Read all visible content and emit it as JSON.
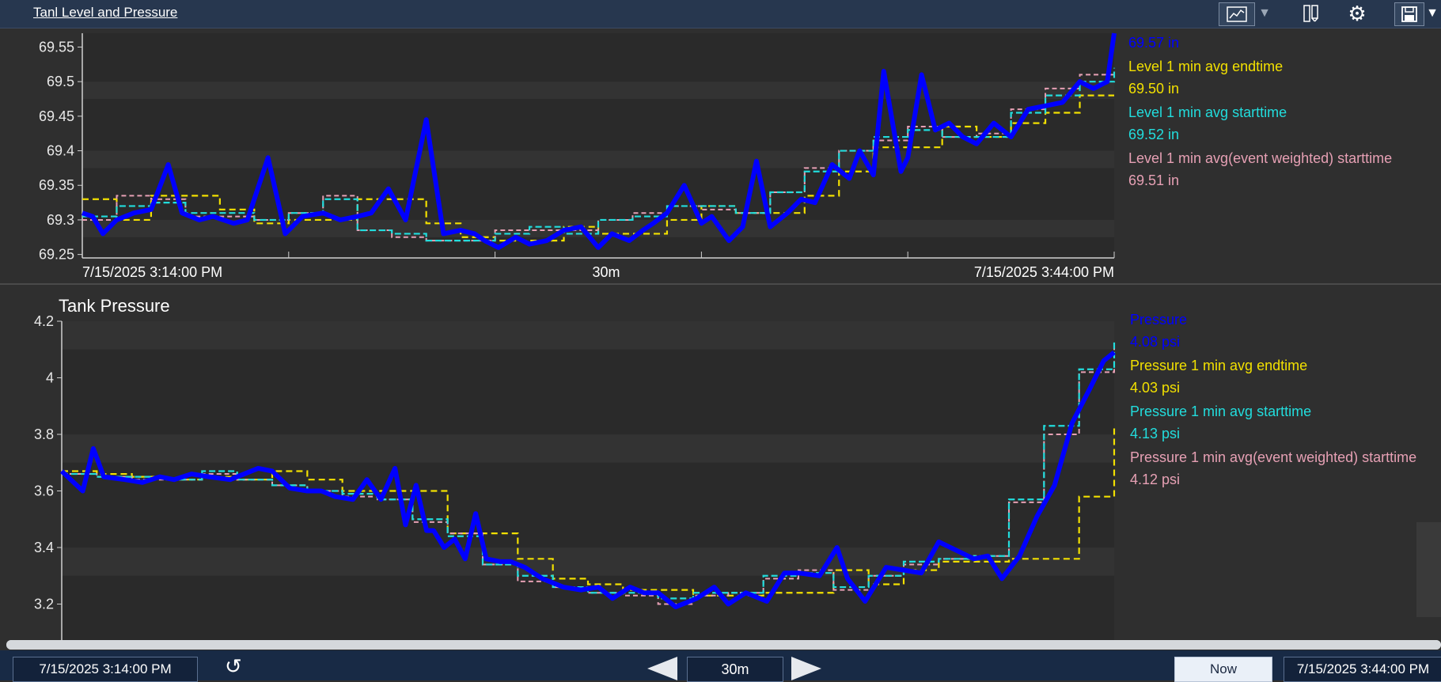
{
  "window": {
    "title": "Tanl Level and Pressure"
  },
  "toolbar": {
    "trend_icon": "trend-chart-icon",
    "caret_icon": "caret-down-icon",
    "columns_icon": "columns-icon",
    "gear_icon": "gear-icon",
    "save_icon": "save-icon"
  },
  "colors": {
    "raw": "#0000ff",
    "endtime": "#f2e000",
    "starttime": "#22dddd",
    "weighted": "#e6a0b4",
    "plot_bg": "#2a2a2a",
    "band": "#333333"
  },
  "chart_data": [
    {
      "type": "line",
      "title": "",
      "x_labels": [
        "7/15/2025 3:14:00 PM",
        "30m",
        "7/15/2025 3:44:00 PM"
      ],
      "yticks": [
        69.25,
        69.3,
        69.35,
        69.4,
        69.45,
        69.5,
        69.55
      ],
      "ytick_labels": [
        "69.25",
        "69.3",
        "69.35",
        "69.4",
        "69.45",
        "69.5",
        "69.55"
      ],
      "ylim": [
        69.245,
        69.57
      ],
      "xlim": [
        0,
        30
      ],
      "legend": [
        {
          "name": "",
          "value": "69.57 in",
          "color_key": "raw"
        },
        {
          "name": "Level 1 min avg endtime",
          "value": "69.50 in",
          "color_key": "endtime"
        },
        {
          "name": "Level 1 min avg starttime",
          "value": "69.52 in",
          "color_key": "starttime"
        },
        {
          "name": "Level 1 min avg(event weighted) starttime",
          "value": "69.51 in",
          "color_key": "weighted"
        }
      ],
      "series": [
        {
          "key": "raw",
          "x": [
            0,
            0.3,
            0.6,
            1,
            1.5,
            2,
            2.5,
            2.9,
            3.4,
            3.8,
            4.4,
            4.8,
            5.4,
            5.9,
            6.4,
            7.0,
            7.5,
            8.0,
            8.4,
            8.9,
            9.4,
            10.0,
            10.5,
            11.0,
            11.4,
            11.7,
            12.1,
            12.6,
            13.0,
            13.5,
            14.0,
            14.5,
            15.0,
            15.4,
            15.9,
            16.3,
            16.6,
            17.0,
            17.5,
            18.0,
            18.3,
            18.8,
            19.2,
            19.6,
            20.0,
            20.5,
            20.9,
            21.3,
            21.8,
            22.3,
            22.6,
            23.0,
            23.3,
            23.8,
            24.0,
            24.4,
            24.8,
            25.2,
            25.6,
            26.0,
            26.5,
            27.0,
            27.5,
            28.0,
            28.5,
            29.0,
            29.4,
            29.8,
            30.0
          ],
          "y": [
            69.31,
            69.305,
            69.28,
            69.3,
            69.31,
            69.315,
            69.38,
            69.31,
            69.3,
            69.305,
            69.295,
            69.3,
            69.39,
            69.28,
            69.305,
            69.31,
            69.3,
            69.305,
            69.31,
            69.345,
            69.3,
            69.445,
            69.28,
            69.285,
            69.28,
            69.27,
            69.26,
            69.275,
            69.265,
            69.27,
            69.285,
            69.29,
            69.26,
            69.28,
            69.27,
            69.285,
            69.295,
            69.31,
            69.35,
            69.295,
            69.305,
            69.27,
            69.29,
            69.385,
            69.29,
            69.31,
            69.33,
            69.325,
            69.38,
            69.36,
            69.4,
            69.365,
            69.515,
            69.37,
            69.39,
            69.51,
            69.43,
            69.44,
            69.42,
            69.41,
            69.44,
            69.42,
            69.46,
            69.465,
            69.47,
            69.5,
            69.49,
            69.5,
            69.57
          ]
        },
        {
          "key": "endtime",
          "step": true,
          "x": [
            0,
            1,
            2,
            3,
            4,
            5,
            6,
            7,
            8,
            9,
            10,
            11,
            12,
            13,
            14,
            15,
            16,
            17,
            18,
            19,
            20,
            21,
            22,
            23,
            24,
            25,
            26,
            27,
            28,
            29,
            30
          ],
          "y": [
            69.33,
            69.3,
            69.335,
            69.335,
            69.315,
            69.295,
            69.3,
            69.3,
            69.33,
            69.33,
            69.295,
            69.275,
            69.27,
            69.27,
            69.29,
            69.28,
            69.28,
            69.3,
            69.32,
            69.31,
            69.31,
            69.335,
            69.37,
            69.405,
            69.405,
            69.435,
            69.42,
            69.44,
            69.455,
            69.48,
            69.48
          ]
        },
        {
          "key": "starttime",
          "step": true,
          "x": [
            0,
            1,
            2,
            3,
            4,
            5,
            6,
            7,
            8,
            9,
            10,
            11,
            12,
            13,
            14,
            15,
            16,
            17,
            18,
            19,
            20,
            21,
            22,
            23,
            24,
            25,
            26,
            27,
            28,
            29,
            30
          ],
          "y": [
            69.305,
            69.32,
            69.325,
            69.31,
            69.31,
            69.3,
            69.31,
            69.33,
            69.285,
            69.28,
            69.27,
            69.27,
            69.28,
            69.29,
            69.28,
            69.3,
            69.305,
            69.32,
            69.32,
            69.31,
            69.34,
            69.37,
            69.4,
            69.42,
            69.43,
            69.42,
            69.42,
            69.455,
            69.48,
            69.5,
            69.52
          ]
        },
        {
          "key": "weighted",
          "step": true,
          "x": [
            0,
            1,
            2,
            3,
            4,
            5,
            6,
            7,
            8,
            9,
            10,
            11,
            12,
            13,
            14,
            15,
            16,
            17,
            18,
            19,
            20,
            21,
            22,
            23,
            24,
            25,
            26,
            27,
            28,
            29,
            30
          ],
          "y": [
            69.3,
            69.335,
            69.33,
            69.305,
            69.305,
            69.3,
            69.31,
            69.335,
            69.285,
            69.275,
            69.27,
            69.27,
            69.285,
            69.285,
            69.285,
            69.3,
            69.31,
            69.32,
            69.315,
            69.31,
            69.34,
            69.375,
            69.4,
            69.415,
            69.435,
            69.42,
            69.425,
            69.46,
            69.49,
            69.51,
            69.51
          ]
        }
      ]
    },
    {
      "type": "line",
      "title": "Tank Pressure",
      "yticks": [
        3.2,
        3.4,
        3.6,
        3.8,
        4,
        4.2
      ],
      "ytick_labels": [
        "3.2",
        "3.4",
        "3.6",
        "3.8",
        "4",
        "4.2"
      ],
      "ylim": [
        3.07,
        4.2
      ],
      "xlim": [
        0,
        30
      ],
      "legend": [
        {
          "name": "Pressure",
          "value": "4.08 psi",
          "color_key": "raw"
        },
        {
          "name": "Pressure 1 min avg endtime",
          "value": "4.03 psi",
          "color_key": "endtime"
        },
        {
          "name": "Pressure 1 min avg starttime",
          "value": "4.13 psi",
          "color_key": "starttime"
        },
        {
          "name": "Pressure 1 min avg(event weighted) starttime",
          "value": "4.12 psi",
          "color_key": "weighted"
        }
      ],
      "series": [
        {
          "key": "raw",
          "x": [
            0,
            0.6,
            0.9,
            1.2,
            1.8,
            2.3,
            2.8,
            3.2,
            3.7,
            4.2,
            4.8,
            5.2,
            5.6,
            6.0,
            6.5,
            7.0,
            7.4,
            7.8,
            8.3,
            8.7,
            9.1,
            9.5,
            9.8,
            10.1,
            10.4,
            10.6,
            10.9,
            11.2,
            11.5,
            11.8,
            12.1,
            12.5,
            12.8,
            13.2,
            13.7,
            14.3,
            14.8,
            15.3,
            15.7,
            16.2,
            16.6,
            17.0,
            17.5,
            18.1,
            18.6,
            19.0,
            19.5,
            20.1,
            20.6,
            21.0,
            21.6,
            22.1,
            22.4,
            22.9,
            23.5,
            24.0,
            24.5,
            25.0,
            25.5,
            26.0,
            26.4,
            26.8,
            27.3,
            27.8,
            28.3,
            28.8,
            29.3,
            29.7,
            30.0
          ],
          "y": [
            3.67,
            3.6,
            3.75,
            3.65,
            3.64,
            3.63,
            3.65,
            3.64,
            3.66,
            3.65,
            3.64,
            3.66,
            3.68,
            3.67,
            3.61,
            3.6,
            3.6,
            3.58,
            3.57,
            3.64,
            3.57,
            3.68,
            3.48,
            3.62,
            3.46,
            3.46,
            3.4,
            3.43,
            3.36,
            3.52,
            3.36,
            3.35,
            3.35,
            3.33,
            3.29,
            3.26,
            3.25,
            3.26,
            3.22,
            3.26,
            3.24,
            3.24,
            3.19,
            3.22,
            3.26,
            3.2,
            3.24,
            3.21,
            3.31,
            3.31,
            3.3,
            3.4,
            3.29,
            3.21,
            3.33,
            3.32,
            3.31,
            3.42,
            3.39,
            3.36,
            3.37,
            3.29,
            3.37,
            3.51,
            3.62,
            3.84,
            3.96,
            4.06,
            4.09
          ]
        },
        {
          "key": "endtime",
          "step": true,
          "x": [
            0,
            1,
            2,
            3,
            4,
            5,
            6,
            7,
            8,
            9,
            10,
            11,
            12,
            13,
            14,
            15,
            16,
            17,
            18,
            19,
            20,
            21,
            22,
            23,
            24,
            25,
            26,
            27,
            28,
            29,
            30
          ],
          "y": [
            3.67,
            3.66,
            3.65,
            3.64,
            3.65,
            3.64,
            3.67,
            3.64,
            3.6,
            3.6,
            3.6,
            3.45,
            3.45,
            3.36,
            3.29,
            3.27,
            3.25,
            3.25,
            3.23,
            3.23,
            3.24,
            3.24,
            3.32,
            3.27,
            3.32,
            3.35,
            3.35,
            3.36,
            3.36,
            3.58,
            3.83
          ]
        },
        {
          "key": "starttime",
          "step": true,
          "x": [
            0,
            1,
            2,
            3,
            4,
            5,
            6,
            7,
            8,
            9,
            10,
            11,
            12,
            13,
            14,
            15,
            16,
            17,
            18,
            19,
            20,
            21,
            22,
            23,
            24,
            25,
            26,
            27,
            28,
            29,
            30
          ],
          "y": [
            3.66,
            3.65,
            3.65,
            3.64,
            3.67,
            3.64,
            3.62,
            3.6,
            3.59,
            3.57,
            3.5,
            3.44,
            3.34,
            3.3,
            3.26,
            3.24,
            3.24,
            3.22,
            3.24,
            3.24,
            3.3,
            3.31,
            3.26,
            3.3,
            3.35,
            3.36,
            3.37,
            3.57,
            3.83,
            4.03,
            4.13
          ]
        },
        {
          "key": "weighted",
          "step": true,
          "x": [
            0,
            1,
            2,
            3,
            4,
            5,
            6,
            7,
            8,
            9,
            10,
            11,
            12,
            13,
            14,
            15,
            16,
            17,
            18,
            19,
            20,
            21,
            22,
            23,
            24,
            25,
            26,
            27,
            28,
            29,
            30
          ],
          "y": [
            3.66,
            3.65,
            3.64,
            3.64,
            3.66,
            3.64,
            3.62,
            3.6,
            3.58,
            3.57,
            3.49,
            3.45,
            3.34,
            3.28,
            3.26,
            3.24,
            3.23,
            3.2,
            3.23,
            3.24,
            3.29,
            3.32,
            3.25,
            3.3,
            3.34,
            3.36,
            3.37,
            3.56,
            3.8,
            4.02,
            4.12
          ]
        }
      ]
    }
  ],
  "bottom": {
    "start_time": "7/15/2025 3:14:00 PM",
    "end_time": "7/15/2025 3:44:00 PM",
    "duration": "30m",
    "now_label": "Now",
    "reset_icon": "reset-icon",
    "back_icon": "arrow-left-icon",
    "forward_icon": "arrow-right-icon"
  }
}
